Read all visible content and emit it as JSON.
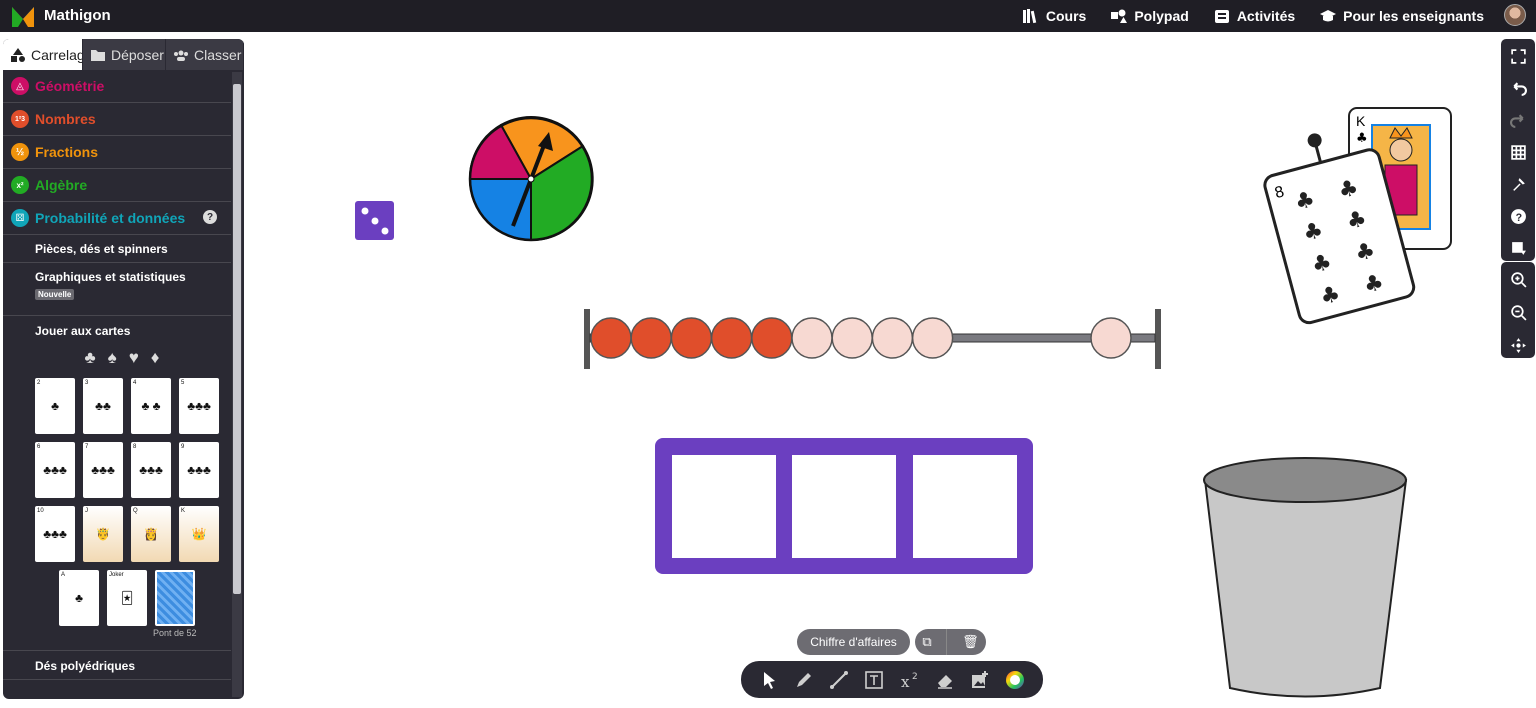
{
  "app": {
    "brand": "Mathigon"
  },
  "nav": [
    {
      "label": "Cours",
      "icon": "books-icon"
    },
    {
      "label": "Polypad",
      "icon": "polypad-icon"
    },
    {
      "label": "Activités",
      "icon": "activities-icon"
    },
    {
      "label": "Pour les enseignants",
      "icon": "graduation-cap-icon"
    }
  ],
  "sidebar": {
    "tabs": [
      {
        "label": "Carrelages",
        "active": true
      },
      {
        "label": "Déposer"
      },
      {
        "label": "Classer"
      }
    ],
    "categories": [
      {
        "label": "Géométrie",
        "color": "#cd0e66",
        "glyph": "◬"
      },
      {
        "label": "Nombres",
        "color": "#e04e2b",
        "glyph": "1²3"
      },
      {
        "label": "Fractions",
        "color": "#f0930c",
        "glyph": "½"
      },
      {
        "label": "Algèbre",
        "color": "#22ab24",
        "glyph": "x²"
      },
      {
        "label": "Probabilité et données",
        "color": "#0f82f2",
        "glyph": "⚄",
        "help": "?"
      }
    ],
    "subsections": {
      "coins": "Pièces, dés et spinners",
      "graphs": "Graphiques et statistiques",
      "graphs_badge": "Nouvelle",
      "cards": "Jouer aux cartes",
      "dice": "Dés polyédriques"
    },
    "suits": [
      "♣",
      "♠",
      "♥",
      "♦"
    ],
    "cards": [
      "2",
      "3",
      "4",
      "5",
      "6",
      "7",
      "8",
      "9",
      "10",
      "J",
      "Q",
      "K"
    ],
    "cards_row2": [
      "A",
      "Joker",
      "Pont de 52"
    ],
    "deck_label": "Pont de 52"
  },
  "canvas": {
    "pill_label": "Chiffre d'affaires",
    "bead_count_red": 5,
    "bead_count_light": 5,
    "dice_value": 3
  },
  "toolbar_right": [
    "fullscreen-icon",
    "undo-icon",
    "redo-icon",
    "grid-icon",
    "tools-icon",
    "help-icon",
    "download-icon"
  ],
  "toolbar_zoom": [
    "zoom-in-icon",
    "zoom-out-icon",
    "pan-icon"
  ],
  "drawing_tools": [
    "pointer-icon",
    "pen-icon",
    "line-icon",
    "text-icon",
    "equation-icon",
    "eraser-icon",
    "add-image-icon",
    "color-wheel-icon"
  ]
}
